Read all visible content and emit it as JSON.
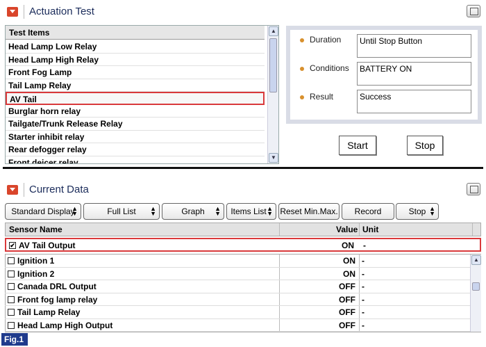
{
  "actuation": {
    "title": "Actuation Test",
    "list_header": "Test Items",
    "items": [
      "Head Lamp Low Relay",
      "Head Lamp High Relay",
      "Front Fog Lamp",
      "Tail Lamp Relay",
      "AV Tail",
      "Burglar horn relay",
      "Tailgate/Trunk Release Relay",
      "Starter inhibit relay",
      "Rear defogger relay",
      "Front deicer relay"
    ],
    "selected_index": 4,
    "info": {
      "duration_label": "Duration",
      "duration_value": "Until Stop Button",
      "conditions_label": "Conditions",
      "conditions_value": "BATTERY ON",
      "result_label": "Result",
      "result_value": "Success"
    },
    "start_label": "Start",
    "stop_label": "Stop"
  },
  "current": {
    "title": "Current Data",
    "toolbar": [
      "Standard Display",
      "Full List",
      "Graph",
      "Items List",
      "Reset Min.Max.",
      "Record",
      "Stop"
    ],
    "columns": {
      "name": "Sensor Name",
      "value": "Value",
      "unit": "Unit"
    },
    "selected_row": {
      "name": "AV Tail Output",
      "value": "ON",
      "unit": "-",
      "checked": true
    },
    "rows": [
      {
        "name": "Ignition 1",
        "value": "ON",
        "unit": "-"
      },
      {
        "name": "Ignition 2",
        "value": "ON",
        "unit": "-"
      },
      {
        "name": "Canada DRL Output",
        "value": "OFF",
        "unit": "-"
      },
      {
        "name": "Front fog lamp relay",
        "value": "OFF",
        "unit": "-"
      },
      {
        "name": "Tail Lamp Relay",
        "value": "OFF",
        "unit": "-"
      },
      {
        "name": "Head Lamp High Output",
        "value": "OFF",
        "unit": "-"
      }
    ]
  },
  "figure_label": "Fig.1",
  "colors": {
    "accent_red": "#d9393b",
    "header_icon": "#d9452b",
    "fig_badge": "#1f3a8c"
  }
}
